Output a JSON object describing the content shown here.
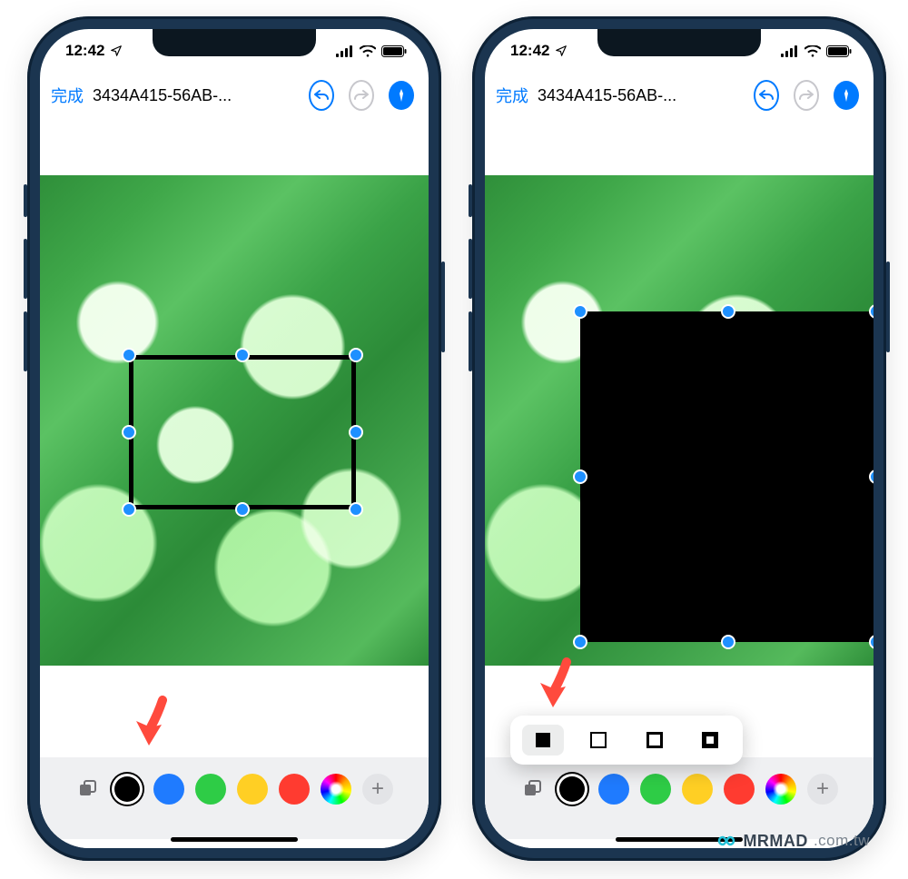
{
  "status": {
    "time": "12:42"
  },
  "nav": {
    "done": "完成",
    "filename": "3434A415-56AB-..."
  },
  "palette": {
    "colors": {
      "black": "#000000",
      "blue": "#1f7bff",
      "green": "#2ecc46",
      "yellow": "#ffcf24",
      "red": "#ff3b30"
    }
  },
  "watermark": {
    "brand": "MRMAD",
    "suffix": ".com.tw"
  }
}
